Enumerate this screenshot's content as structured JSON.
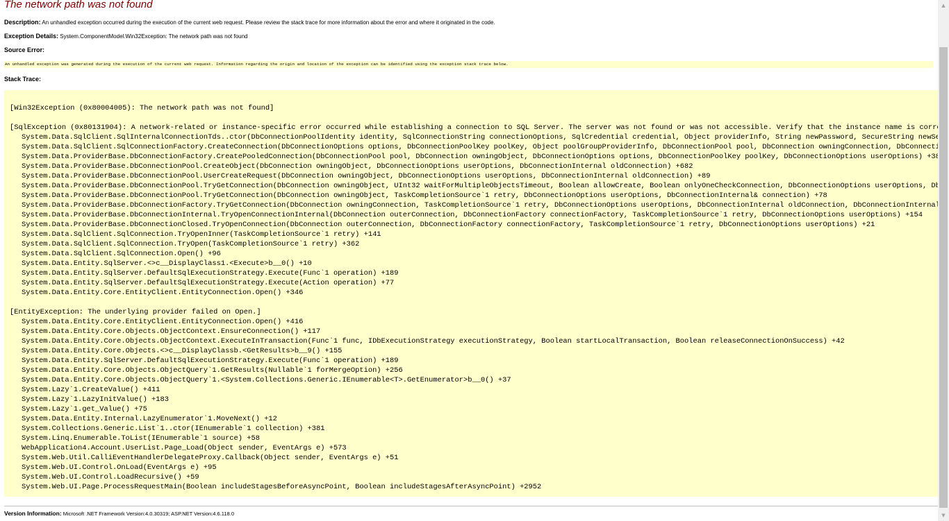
{
  "title": "The network path was not found",
  "description": {
    "label": "Description:",
    "text": "An unhandled exception occurred during the execution of the current web request. Please review the stack trace for more information about the error and where it originated in the code."
  },
  "exception_details": {
    "label": "Exception Details:",
    "text": "System.ComponentModel.Win32Exception: The network path was not found"
  },
  "source_error": {
    "label": "Source Error:",
    "text": "An unhandled exception was generated during the execution of the current web request. Information regarding the origin and location of the exception can be identified using the exception stack trace below."
  },
  "stack_trace": {
    "label": "Stack Trace:",
    "lines": [
      {
        "kind": "header",
        "text": "[Win32Exception (0x80004005): The network path was not found]"
      },
      {
        "kind": "gap",
        "text": ""
      },
      {
        "kind": "header",
        "text": "[SqlException (0x80131904): A network-related or instance-specific error occurred while establishing a connection to SQL Server. The server was not found or was not accessible. Verify that the instance name is correct and"
      },
      {
        "kind": "frame",
        "text": "System.Data.SqlClient.SqlInternalConnectionTds..ctor(DbConnectionPoolIdentity identity, SqlConnectionString connectionOptions, SqlCredential credential, Object providerInfo, String newPassword, SecureString newSecurePa"
      },
      {
        "kind": "frame",
        "text": "System.Data.SqlClient.SqlConnectionFactory.CreateConnection(DbConnectionOptions options, DbConnectionPoolKey poolKey, Object poolGroupProviderInfo, DbConnectionPool pool, DbConnection owningConnection, DbConnectionOpti"
      },
      {
        "kind": "frame",
        "text": "System.Data.ProviderBase.DbConnectionFactory.CreatePooledConnection(DbConnectionPool pool, DbConnection owningObject, DbConnectionOptions options, DbConnectionPoolKey poolKey, DbConnectionOptions userOptions) +38"
      },
      {
        "kind": "frame",
        "text": "System.Data.ProviderBase.DbConnectionPool.CreateObject(DbConnection owningObject, DbConnectionOptions userOptions, DbConnectionInternal oldConnection) +682"
      },
      {
        "kind": "frame",
        "text": "System.Data.ProviderBase.DbConnectionPool.UserCreateRequest(DbConnection owningObject, DbConnectionOptions userOptions, DbConnectionInternal oldConnection) +89"
      },
      {
        "kind": "frame",
        "text": "System.Data.ProviderBase.DbConnectionPool.TryGetConnection(DbConnection owningObject, UInt32 waitForMultipleObjectsTimeout, Boolean allowCreate, Boolean onlyOneCheckConnection, DbConnectionOptions userOptions, DbConnec"
      },
      {
        "kind": "frame",
        "text": "System.Data.ProviderBase.DbConnectionPool.TryGetConnection(DbConnection owningObject, TaskCompletionSource`1 retry, DbConnectionOptions userOptions, DbConnectionInternal& connection) +78"
      },
      {
        "kind": "frame",
        "text": "System.Data.ProviderBase.DbConnectionFactory.TryGetConnection(DbConnection owningConnection, TaskCompletionSource`1 retry, DbConnectionOptions userOptions, DbConnectionInternal oldConnection, DbConnectionInternal& conn"
      },
      {
        "kind": "frame",
        "text": "System.Data.ProviderBase.DbConnectionInternal.TryOpenConnectionInternal(DbConnection outerConnection, DbConnectionFactory connectionFactory, TaskCompletionSource`1 retry, DbConnectionOptions userOptions) +154"
      },
      {
        "kind": "frame",
        "text": "System.Data.ProviderBase.DbConnectionClosed.TryOpenConnection(DbConnection outerConnection, DbConnectionFactory connectionFactory, TaskCompletionSource`1 retry, DbConnectionOptions userOptions) +21"
      },
      {
        "kind": "frame",
        "text": "System.Data.SqlClient.SqlConnection.TryOpenInner(TaskCompletionSource`1 retry) +141"
      },
      {
        "kind": "frame",
        "text": "System.Data.SqlClient.SqlConnection.TryOpen(TaskCompletionSource`1 retry) +362"
      },
      {
        "kind": "frame",
        "text": "System.Data.SqlClient.SqlConnection.Open() +96"
      },
      {
        "kind": "frame",
        "text": "System.Data.Entity.SqlServer.<>c__DisplayClass1.<Execute>b__0() +10"
      },
      {
        "kind": "frame",
        "text": "System.Data.Entity.SqlServer.DefaultSqlExecutionStrategy.Execute(Func`1 operation) +189"
      },
      {
        "kind": "frame",
        "text": "System.Data.Entity.SqlServer.DefaultSqlExecutionStrategy.Execute(Action operation) +77"
      },
      {
        "kind": "frame",
        "text": "System.Data.Entity.Core.EntityClient.EntityConnection.Open() +346"
      },
      {
        "kind": "gap",
        "text": ""
      },
      {
        "kind": "header",
        "text": "[EntityException: The underlying provider failed on Open.]"
      },
      {
        "kind": "frame",
        "text": "System.Data.Entity.Core.EntityClient.EntityConnection.Open() +416"
      },
      {
        "kind": "frame",
        "text": "System.Data.Entity.Core.Objects.ObjectContext.EnsureConnection() +117"
      },
      {
        "kind": "frame",
        "text": "System.Data.Entity.Core.Objects.ObjectContext.ExecuteInTransaction(Func`1 func, IDbExecutionStrategy executionStrategy, Boolean startLocalTransaction, Boolean releaseConnectionOnSuccess) +42"
      },
      {
        "kind": "frame",
        "text": "System.Data.Entity.Core.Objects.<>c__DisplayClassb.<GetResults>b__9() +155"
      },
      {
        "kind": "frame",
        "text": "System.Data.Entity.SqlServer.DefaultSqlExecutionStrategy.Execute(Func`1 operation) +189"
      },
      {
        "kind": "frame",
        "text": "System.Data.Entity.Core.Objects.ObjectQuery`1.GetResults(Nullable`1 forMergeOption) +256"
      },
      {
        "kind": "frame",
        "text": "System.Data.Entity.Core.Objects.ObjectQuery`1.<System.Collections.Generic.IEnumerable<T>.GetEnumerator>b__0() +37"
      },
      {
        "kind": "frame",
        "text": "System.Lazy`1.CreateValue() +411"
      },
      {
        "kind": "frame",
        "text": "System.Lazy`1.LazyInitValue() +183"
      },
      {
        "kind": "frame",
        "text": "System.Lazy`1.get_Value() +75"
      },
      {
        "kind": "frame",
        "text": "System.Data.Entity.Internal.LazyEnumerator`1.MoveNext() +12"
      },
      {
        "kind": "frame",
        "text": "System.Collections.Generic.List`1..ctor(IEnumerable`1 collection) +381"
      },
      {
        "kind": "frame",
        "text": "System.Linq.Enumerable.ToList(IEnumerable`1 source) +58"
      },
      {
        "kind": "frame",
        "text": "WebApplication4.Account.UserList.Page_Load(Object sender, EventArgs e) +573"
      },
      {
        "kind": "frame",
        "text": "System.Web.Util.CalliEventHandlerDelegateProxy.Callback(Object sender, EventArgs e) +51"
      },
      {
        "kind": "frame",
        "text": "System.Web.UI.Control.OnLoad(EventArgs e) +95"
      },
      {
        "kind": "frame",
        "text": "System.Web.UI.Control.LoadRecursive() +59"
      },
      {
        "kind": "frame",
        "text": "System.Web.UI.Page.ProcessRequestMain(Boolean includeStagesBeforeAsyncPoint, Boolean includeStagesAfterAsyncPoint) +2952"
      }
    ]
  },
  "version_information": {
    "label": "Version Information:",
    "text": "Microsoft .NET Framework Version:4.0.30319; ASP.NET Version:4.6.118.0"
  },
  "colors": {
    "title": "#800000",
    "code_background": "#ffffcc",
    "divider": "#c0c0c0",
    "scrollbar_track": "#f0f0f0",
    "scrollbar_thumb": "#c1c1c1"
  },
  "scrollbar": {
    "up_icon": "triangle-up-icon",
    "down_icon": "triangle-down-icon"
  }
}
